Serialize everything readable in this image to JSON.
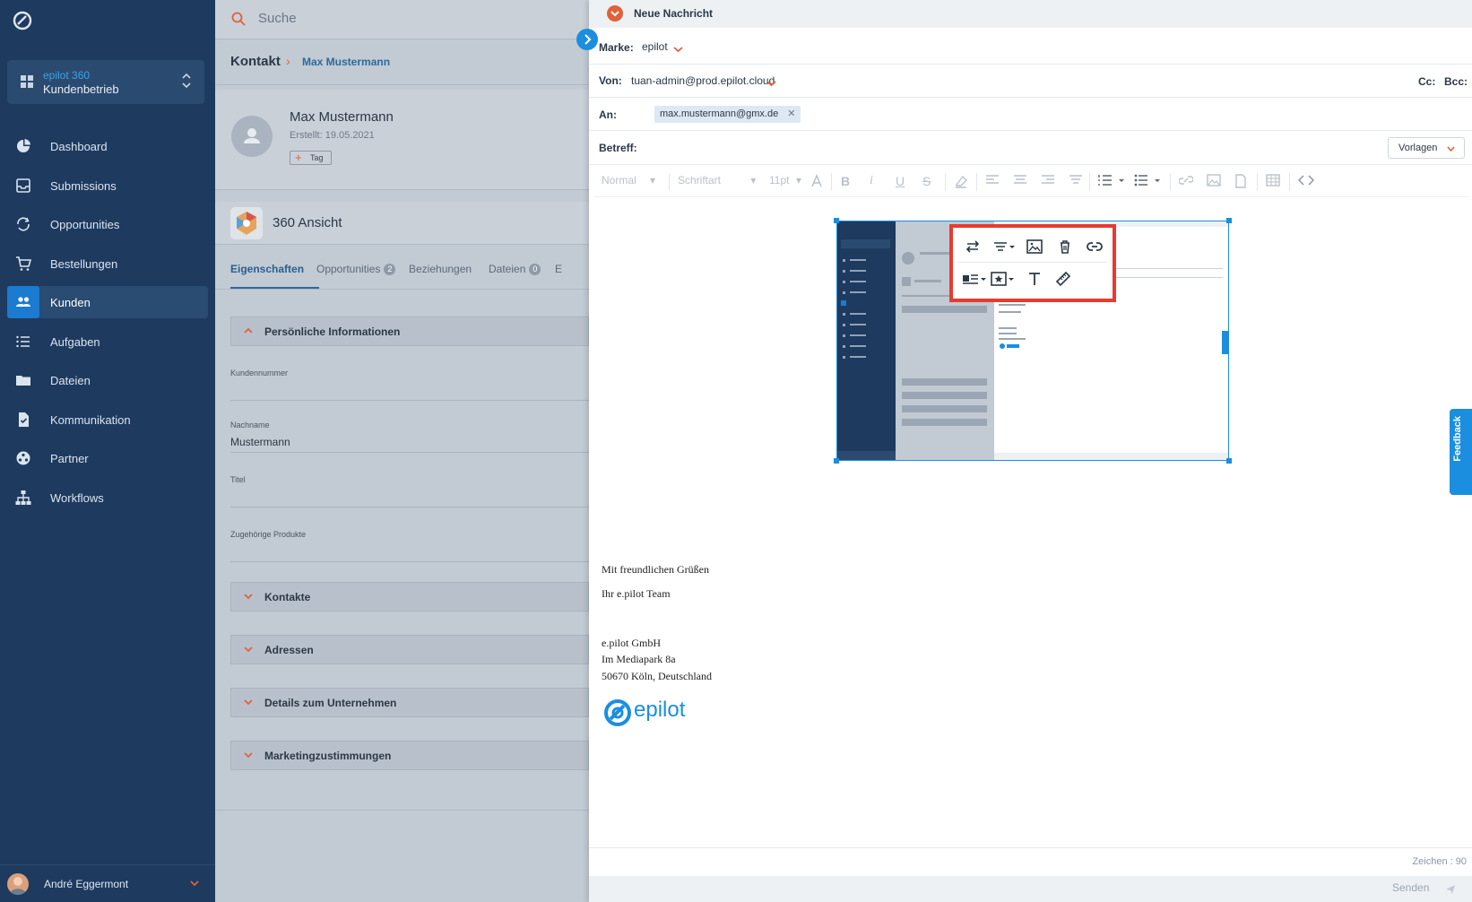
{
  "sidebar": {
    "workspace": {
      "name": "epilot 360",
      "sub": "Kundenbetrieb"
    },
    "items": [
      {
        "label": "Dashboard",
        "icon": "pie-chart-icon"
      },
      {
        "label": "Submissions",
        "icon": "inbox-icon"
      },
      {
        "label": "Opportunities",
        "icon": "sync-icon"
      },
      {
        "label": "Bestellungen",
        "icon": "cart-icon"
      },
      {
        "label": "Kunden",
        "icon": "people-icon"
      },
      {
        "label": "Aufgaben",
        "icon": "list-icon"
      },
      {
        "label": "Dateien",
        "icon": "folder-icon"
      },
      {
        "label": "Kommunikation",
        "icon": "document-check-icon"
      },
      {
        "label": "Partner",
        "icon": "partner-icon"
      },
      {
        "label": "Workflows",
        "icon": "hierarchy-icon"
      }
    ],
    "active_index": 4,
    "user": {
      "name": "André Eggermont"
    }
  },
  "page": {
    "search_placeholder": "Suche",
    "breadcrumb": {
      "root": "Kontakt",
      "current": "Max Mustermann"
    },
    "profile": {
      "name": "Max Mustermann",
      "created": "Erstellt: 19.05.2021",
      "tag_label": "Tag"
    },
    "view_title": "360 Ansicht",
    "tabs": [
      {
        "label": "Eigenschaften"
      },
      {
        "label": "Opportunities",
        "badge": "2"
      },
      {
        "label": "Beziehungen"
      },
      {
        "label": "Dateien",
        "badge": "0"
      },
      {
        "label": "E"
      }
    ],
    "section_personal": "Persönliche Informationen",
    "fields": [
      {
        "label": "Kundennummer",
        "value": ""
      },
      {
        "label": "Nachname",
        "value": "Mustermann"
      },
      {
        "label": "Titel",
        "value": ""
      },
      {
        "label": "Zugehörige Produkte",
        "value": ""
      }
    ],
    "sections": [
      "Kontakte",
      "Adressen",
      "Details zum Unternehmen",
      "Marketingzustimmungen"
    ]
  },
  "compose": {
    "title": "Neue Nachricht",
    "marke_label": "Marke:",
    "marke_value": "epilot",
    "von_label": "Von:",
    "von_value": "tuan-admin@prod.epilot.cloud",
    "cc_label": "Cc:",
    "bcc_label": "Bcc:",
    "an_label": "An:",
    "an_chip": "max.mustermann@gmx.de",
    "betreff_label": "Betreff:",
    "vorlagen_label": "Vorlagen",
    "toolbar": {
      "style": "Normal",
      "font": "Schriftart",
      "size": "11pt"
    },
    "signature": {
      "greeting": "Mit freundlichen Grüßen",
      "team": "Ihr e.pilot Team",
      "company": "e.pilot GmbH",
      "street": "Im Mediapark 8a",
      "city": "50670 Köln, Deutschland",
      "logo_text": "epilot"
    },
    "char_count": "Zeichen : 90",
    "send_label": "Senden"
  },
  "feedback_label": "Feedback",
  "colors": {
    "sidebar": "#1e3a5f",
    "accent": "#1b8ee0",
    "orange": "#e0613a",
    "highlight": "#e83b2e"
  }
}
